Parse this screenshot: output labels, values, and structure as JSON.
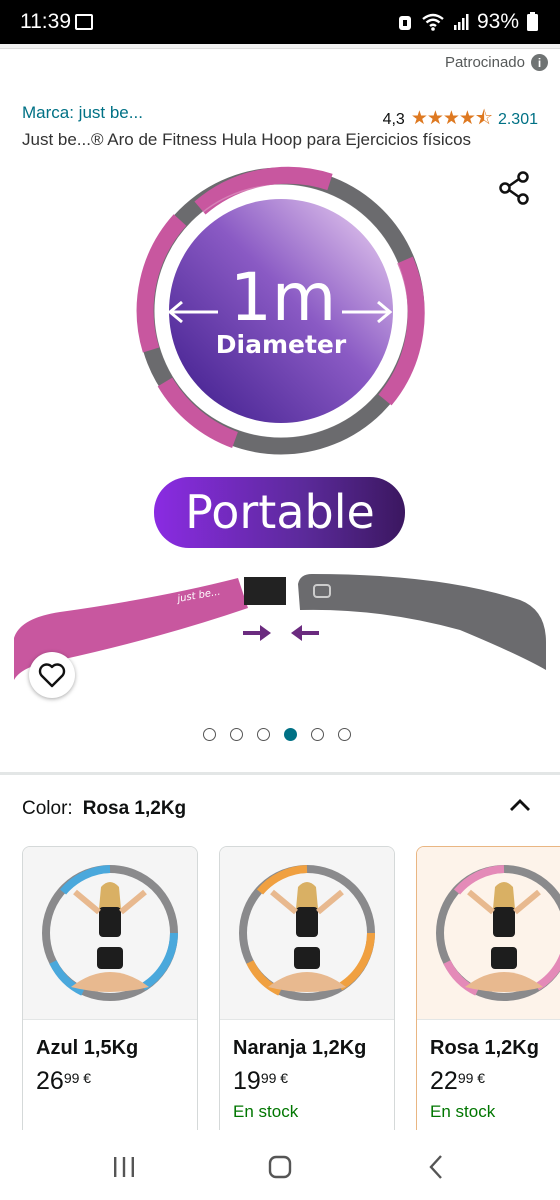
{
  "status_bar": {
    "time": "11:39",
    "battery": "93%"
  },
  "sponsored_label": "Patrocinado",
  "brand_link": "Marca: just be...",
  "rating": {
    "value": "4,3",
    "stars": "★★★★⯪",
    "count": "2.301"
  },
  "product_title": "Just be...® Aro de Fitness Hula Hoop para Ejercicios físicos",
  "image_overlay": {
    "size": "1m",
    "size_caption": "Diameter",
    "banner": "Portable",
    "logo": "just be..."
  },
  "carousel": {
    "total": 6,
    "active_index": 3
  },
  "variant": {
    "label": "Color:",
    "selected": "Rosa 1,2Kg"
  },
  "options": [
    {
      "name": "Azul 1,5Kg",
      "price_whole": "26",
      "price_fraction": "99",
      "currency": "€",
      "stock": "",
      "ring_color": "#4aa8dc"
    },
    {
      "name": "Naranja 1,2Kg",
      "price_whole": "19",
      "price_fraction": "99",
      "currency": "€",
      "stock": "En stock",
      "ring_color": "#f0a040"
    },
    {
      "name": "Rosa 1,2Kg",
      "price_whole": "22",
      "price_fraction": "99",
      "currency": "€",
      "stock": "En stock",
      "ring_color": "#e48ab8"
    }
  ],
  "colors": {
    "link": "#007185",
    "stars": "#de7921",
    "in_stock": "#007600",
    "hoop_pink": "#c8579f",
    "hoop_gray": "#6b6b6e",
    "purple": "#5b2a9a"
  }
}
